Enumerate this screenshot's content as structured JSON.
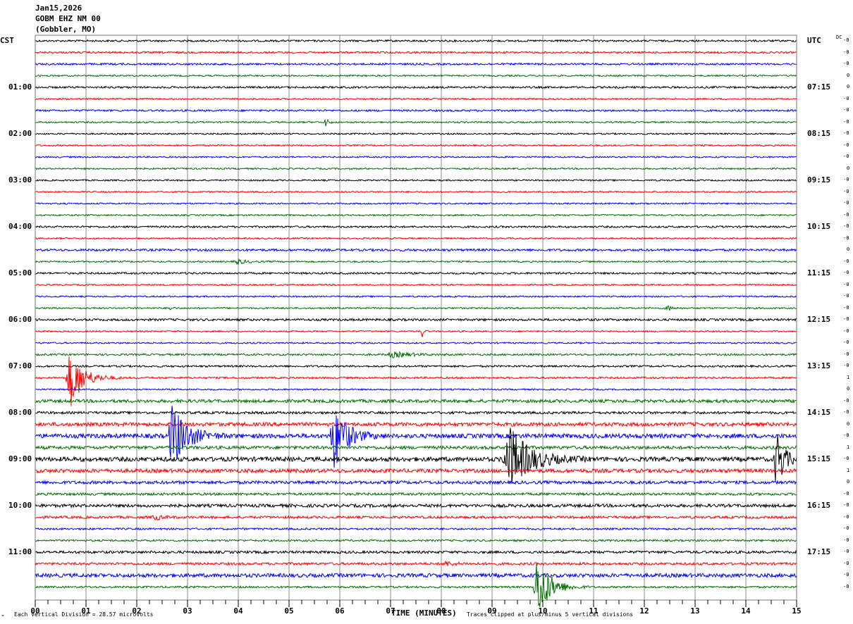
{
  "header": {
    "date": "Jan15,2026",
    "station": "GOBM EHZ NM 00",
    "location": "(Gobbler, MO)"
  },
  "left_tz": "CST",
  "right_tz": "UTC",
  "dc_label": "DC",
  "footer": {
    "scale": "Each Vertical Division =   28.57 microvolts",
    "xlabel": "TIME (MINUTES)",
    "clip_note": "Traces clipped at plus/minus 5 vertical divisions"
  },
  "chart_data": {
    "type": "line",
    "title": "GOBM EHZ NM 00 helicorder",
    "xlabel": "TIME (MINUTES)",
    "xlim": [
      0,
      15
    ],
    "x_ticks": [
      "00",
      "01",
      "02",
      "03",
      "04",
      "05",
      "06",
      "07",
      "08",
      "09",
      "10",
      "11",
      "12",
      "13",
      "14",
      "15"
    ],
    "rows": 48,
    "row_minutes": 15,
    "colors": [
      "#000000",
      "#ff0000",
      "#0000ff",
      "#007000"
    ],
    "left_labels": [
      {
        "row": 4,
        "text": "01:00"
      },
      {
        "row": 8,
        "text": "02:00"
      },
      {
        "row": 12,
        "text": "03:00"
      },
      {
        "row": 16,
        "text": "04:00"
      },
      {
        "row": 20,
        "text": "05:00"
      },
      {
        "row": 24,
        "text": "06:00"
      },
      {
        "row": 28,
        "text": "07:00"
      },
      {
        "row": 32,
        "text": "08:00"
      },
      {
        "row": 36,
        "text": "09:00"
      },
      {
        "row": 40,
        "text": "10:00"
      },
      {
        "row": 44,
        "text": "11:00"
      }
    ],
    "right_labels": [
      {
        "row": 4,
        "text": "07:15"
      },
      {
        "row": 8,
        "text": "08:15"
      },
      {
        "row": 12,
        "text": "09:15"
      },
      {
        "row": 16,
        "text": "10:15"
      },
      {
        "row": 20,
        "text": "11:15"
      },
      {
        "row": 24,
        "text": "12:15"
      },
      {
        "row": 28,
        "text": "13:15"
      },
      {
        "row": 32,
        "text": "14:15"
      },
      {
        "row": 36,
        "text": "15:15"
      },
      {
        "row": 40,
        "text": "16:15"
      },
      {
        "row": 44,
        "text": "17:15"
      }
    ],
    "dc_offsets": [
      "-0",
      "-0",
      "-0",
      "0",
      "0",
      "-0",
      "-0",
      "-0",
      "-0",
      "-0",
      "-0",
      "0",
      "-0",
      "-0",
      "-0",
      "-0",
      "-0",
      "-0",
      "0",
      "-0",
      "-0",
      "-0",
      "-0",
      "-0",
      "-0",
      "-0",
      "-0",
      "-0",
      "-0",
      "1",
      "0",
      "-0",
      "-0",
      "0",
      "-0",
      "1",
      "-0",
      "1",
      "0",
      "-0",
      "-0",
      "-0",
      "-0",
      "-0",
      "-0",
      "-0",
      "-0",
      "-0"
    ],
    "noise_div": [
      0.15,
      0.15,
      0.15,
      0.12,
      0.15,
      0.12,
      0.15,
      0.12,
      0.12,
      0.12,
      0.12,
      0.12,
      0.12,
      0.12,
      0.12,
      0.12,
      0.15,
      0.12,
      0.18,
      0.12,
      0.15,
      0.12,
      0.12,
      0.12,
      0.18,
      0.12,
      0.12,
      0.15,
      0.15,
      0.15,
      0.12,
      0.25,
      0.2,
      0.3,
      0.35,
      0.25,
      0.35,
      0.3,
      0.25,
      0.2,
      0.25,
      0.2,
      0.15,
      0.15,
      0.2,
      0.2,
      0.3,
      0.15
    ],
    "events": [
      {
        "row": 7,
        "start_min": 5.7,
        "duration_min": 0.15,
        "amp_div": 0.8
      },
      {
        "row": 19,
        "start_min": 3.9,
        "duration_min": 0.5,
        "amp_div": 0.4
      },
      {
        "row": 23,
        "start_min": 2.6,
        "duration_min": 0.15,
        "amp_div": 0.6
      },
      {
        "row": 23,
        "start_min": 12.4,
        "duration_min": 0.25,
        "amp_div": 0.6
      },
      {
        "row": 25,
        "start_min": 7.6,
        "duration_min": 0.1,
        "amp_div": 1.2
      },
      {
        "row": 27,
        "start_min": 6.9,
        "duration_min": 1.0,
        "amp_div": 0.4
      },
      {
        "row": 29,
        "start_min": 0.6,
        "duration_min": 0.7,
        "amp_div": 4.5
      },
      {
        "row": 34,
        "start_min": 2.6,
        "duration_min": 0.8,
        "amp_div": 5
      },
      {
        "row": 34,
        "start_min": 5.8,
        "duration_min": 0.7,
        "amp_div": 5
      },
      {
        "row": 36,
        "start_min": 9.2,
        "duration_min": 1.1,
        "amp_div": 5
      },
      {
        "row": 36,
        "start_min": 14.55,
        "duration_min": 0.4,
        "amp_div": 5
      },
      {
        "row": 41,
        "start_min": 2.3,
        "duration_min": 0.4,
        "amp_div": 0.4
      },
      {
        "row": 45,
        "start_min": 8.0,
        "duration_min": 0.6,
        "amp_div": 0.3
      },
      {
        "row": 47,
        "start_min": 9.8,
        "duration_min": 0.7,
        "amp_div": 5
      }
    ]
  }
}
